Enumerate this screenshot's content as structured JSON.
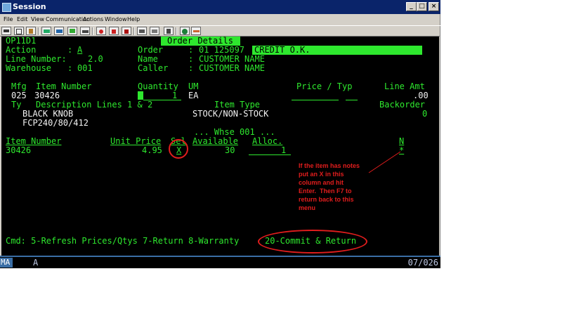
{
  "window": {
    "title": "Session"
  },
  "menu": [
    "File",
    "Edit",
    "View",
    "Communication",
    "Actions",
    "Window",
    "Help"
  ],
  "screen": {
    "program_id": "OP11D1",
    "header_title": "Order Details",
    "action": {
      "label": "Action",
      "colon": ":",
      "value": "A"
    },
    "line_number": {
      "label": "Line Number:",
      "value": "2.0"
    },
    "warehouse": {
      "label": "Warehouse",
      "colon": ":",
      "value": "001"
    },
    "order": {
      "label": "Order",
      "colon": ":",
      "value": "01 125097",
      "status": "CREDIT O.K."
    },
    "name": {
      "label": "Name",
      "colon": ":",
      "value": "CUSTOMER NAME"
    },
    "caller": {
      "label": "Caller",
      "colon": ":",
      "value": "CUSTOMER NAME"
    },
    "item_header": {
      "mfg": "Mfg",
      "item_number": "Item Number",
      "quantity": "Quantity",
      "um": "UM",
      "price_typ": "Price / Typ",
      "line_amt": "Line Amt"
    },
    "item": {
      "mfg": "025",
      "item_number": "30426",
      "quantity": "1",
      "um": "EA",
      "line_amt": ".00"
    },
    "desc_header": {
      "ty": "Ty",
      "description": "Description Lines 1 & 2",
      "item_type": "Item Type",
      "backorder": "Backorder"
    },
    "desc": {
      "line1": "BLACK KNOB",
      "line2": "FCP240/80/412",
      "item_type": "STOCK/NON-STOCK",
      "backorder": "0"
    },
    "whse_title": "... Whse 001 ...",
    "grid_header": {
      "item_number": "Item Number",
      "unit_price": "Unit Price",
      "sel": "Sel",
      "available": "Available",
      "alloc": "Alloc.",
      "n": "N"
    },
    "grid_rows": [
      {
        "item_number": "30426",
        "unit_price": "4.95",
        "sel": "X",
        "available": "30",
        "alloc": "1",
        "n": "*"
      }
    ],
    "cmd_line": "Cmd: 5-Refresh Prices/Qtys 7-Return 8-Warranty",
    "cmd_commit": "20-Commit & Return",
    "note": "If the item has notes\nput an X in this\ncolumn and hit\nEnter.  Then F7 to\nreturn back to this\nmenu"
  },
  "status": {
    "mode": "MA",
    "indicator": "A",
    "cursor": "07/026"
  },
  "colors": {
    "terminal_green": "#2ee82e",
    "annotation_red": "#e11d1d",
    "titlebar": "#0a246a"
  }
}
